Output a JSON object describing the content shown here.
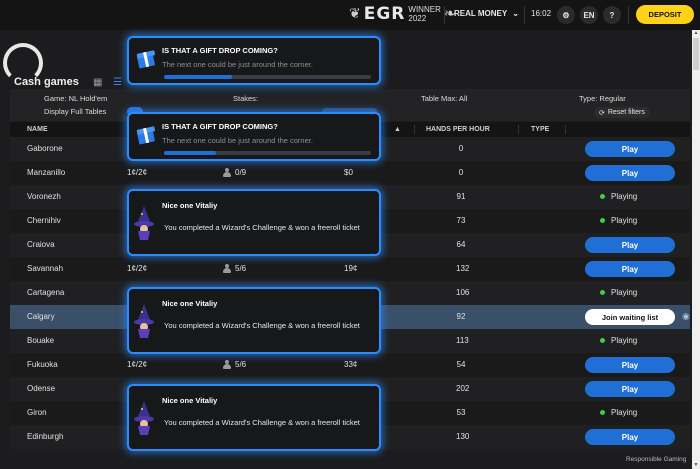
{
  "topbar": {
    "egr_logo": "EGR",
    "egr_winner": "WINNER",
    "egr_year": "2022",
    "money_mode": "REAL MONEY",
    "time": "16:02",
    "language": "EN",
    "help": "?",
    "deposit": "DEPOSIT"
  },
  "page": {
    "title": "Cash games"
  },
  "filters": {
    "game": "Game: NL Hold'em",
    "stakes": "Stakes:",
    "table_max": "Table Max: All",
    "type": "Type: Regular",
    "display_full": "Display Full Tables",
    "reset": "Reset filters"
  },
  "table": {
    "headers": {
      "name": "NAME",
      "hands_per_hour": "HANDS PER HOUR",
      "type": "TYPE"
    },
    "rows": [
      {
        "name": "Gaborone",
        "stakes": "",
        "players": "",
        "avg": "",
        "hands": "0",
        "action": "Play"
      },
      {
        "name": "Manzanillo",
        "stakes": "1¢/2¢",
        "players": "0/9",
        "avg": "$0",
        "hands": "0",
        "action": "Play"
      },
      {
        "name": "Voronezh",
        "stakes": "",
        "players": "",
        "avg": "",
        "hands": "91",
        "action": "Playing"
      },
      {
        "name": "Chernihiv",
        "stakes": "",
        "players": "",
        "avg": "",
        "hands": "73",
        "action": "Playing"
      },
      {
        "name": "Craiova",
        "stakes": "",
        "players": "",
        "avg": "",
        "hands": "64",
        "action": "Play"
      },
      {
        "name": "Savannah",
        "stakes": "1¢/2¢",
        "players": "5/6",
        "avg": "19¢",
        "hands": "132",
        "action": "Play"
      },
      {
        "name": "Cartagena",
        "stakes": "",
        "players": "",
        "avg": "",
        "hands": "106",
        "action": "Playing"
      },
      {
        "name": "Calgary",
        "stakes": "",
        "players": "",
        "avg": "",
        "hands": "92",
        "action": "Join waiting list"
      },
      {
        "name": "Bouake",
        "stakes": "",
        "players": "",
        "avg": "",
        "hands": "113",
        "action": "Playing"
      },
      {
        "name": "Fukuoka",
        "stakes": "1¢/2¢",
        "players": "5/6",
        "avg": "33¢",
        "hands": "54",
        "action": "Play"
      },
      {
        "name": "Odense",
        "stakes": "",
        "players": "",
        "avg": "",
        "hands": "202",
        "action": "Play"
      },
      {
        "name": "Giron",
        "stakes": "",
        "players": "",
        "avg": "",
        "hands": "53",
        "action": "Playing"
      },
      {
        "name": "Edinburgh",
        "stakes": "",
        "players": "",
        "avg": "",
        "hands": "130",
        "action": "Play"
      }
    ]
  },
  "footer": {
    "responsible": "Responsible Gaming"
  },
  "toasts": {
    "gift": [
      {
        "title": "IS THAT A GIFT DROP COMING?",
        "subtitle": "The next one could be just around the corner.",
        "progress": 0.33
      },
      {
        "title": "IS THAT A GIFT DROP COMING?",
        "subtitle": "The next one could be just around the corner.",
        "progress": 0.25
      }
    ],
    "wizard": [
      {
        "title": "Nice one Vitaliy",
        "body": "You completed a Wizard's Challenge & won a freeroll ticket"
      },
      {
        "title": "Nice one Vitaliy",
        "body": "You completed a Wizard's Challenge & won a freeroll ticket"
      },
      {
        "title": "Nice one Vitaliy",
        "body": "You completed a Wizard's Challenge & won a freeroll ticket"
      }
    ]
  },
  "colors": {
    "accent": "#1f6fd6",
    "deposit": "#ffd21a",
    "playing_dot": "#37d24a",
    "toast_glow": "#2a8cff"
  }
}
